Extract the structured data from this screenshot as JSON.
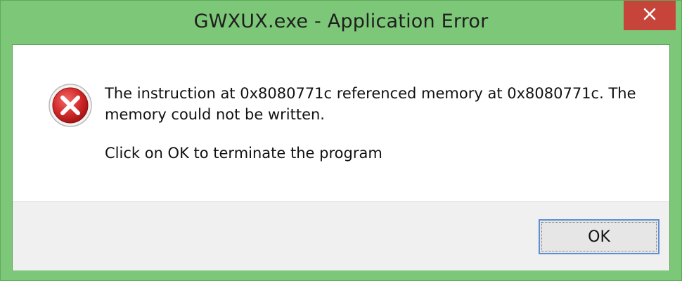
{
  "window": {
    "title": "GWXUX.exe - Application Error",
    "close_icon": "close-icon"
  },
  "dialog": {
    "icon": "error-icon",
    "message_line1": "The instruction at 0x8080771c referenced memory at 0x8080771c. The memory could not be written.",
    "message_line2": "Click on OK to terminate the program",
    "ok_label": "OK"
  },
  "colors": {
    "frame": "#7cc878",
    "close_button": "#c7443a",
    "ok_border": "#5c8fd6"
  }
}
